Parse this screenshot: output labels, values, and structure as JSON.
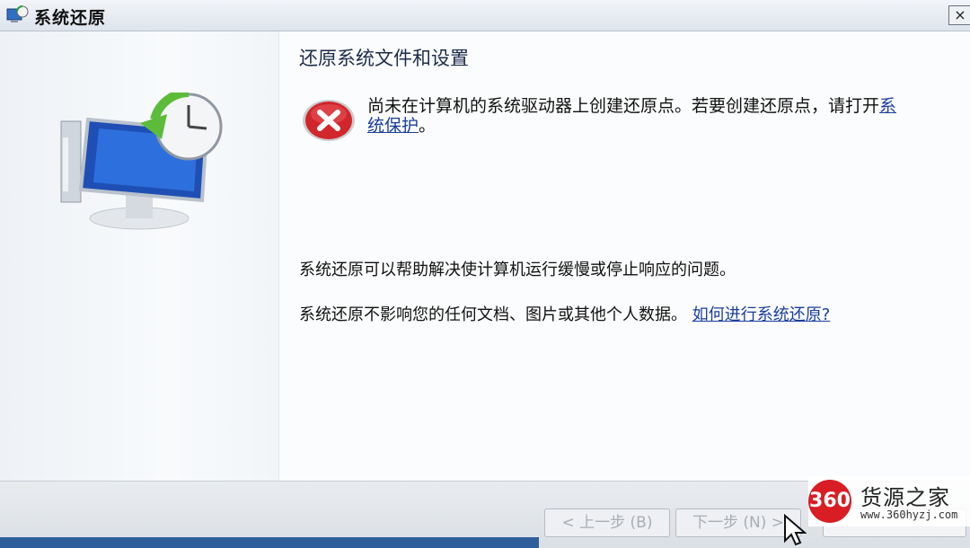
{
  "window": {
    "title": "系统还原",
    "close_label": "×"
  },
  "content": {
    "title": "还原系统文件和设置",
    "error": {
      "message_prefix": "尚未在计算机的系统驱动器上创建还原点。若要创建还原点，请打开",
      "link_text": "系统保护",
      "message_suffix": "。"
    },
    "description_1": "系统还原可以帮助解决使计算机运行缓慢或停止响应的问题。",
    "description_2": "系统还原不影响您的任何文档、图片或其他个人数据。",
    "help_link": "如何进行系统还原?"
  },
  "footer": {
    "back_label": "< 上一步 (B)",
    "next_label": "下一步 (N) >",
    "third_label": ""
  },
  "watermark": {
    "logo_text": "360",
    "name": "货源之家",
    "url": "www.360hyzj.com"
  },
  "colors": {
    "link": "#1a3d9c",
    "error_red": "#d1262b",
    "title_text": "#1c2b4a"
  }
}
